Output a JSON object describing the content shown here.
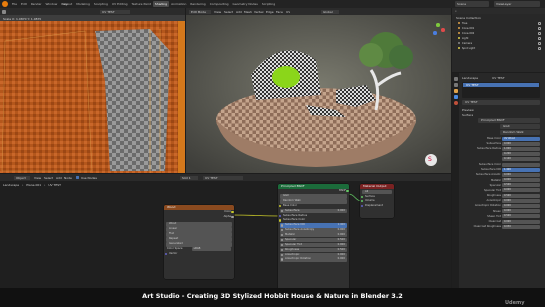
{
  "topbar": {
    "menus": [
      "File",
      "Edit",
      "Render",
      "Window",
      "Help"
    ],
    "workspaces": [
      "Layout",
      "Modeling",
      "Sculpting",
      "UV Editing",
      "Texture Paint",
      "Shading",
      "Animation",
      "Rendering",
      "Compositing",
      "Geometry Nodes",
      "Scripting"
    ],
    "active_workspace": "Shading",
    "scene": "Scene",
    "view_layer": "ViewLayer"
  },
  "image_editor": {
    "header": "UV TEST",
    "info": "Scale X: 1.0870  Y: 1.0870"
  },
  "viewport": {
    "mode": "Edit Mode",
    "view": "View",
    "select": "Select",
    "add": "Add",
    "mesh": "Mesh",
    "vertex": "Vertex",
    "edge": "Edge",
    "face": "Face",
    "uv": "UV",
    "orientation": "Global",
    "perspective": "User Perspective",
    "object_label": "(1) Plane.001",
    "options": "Options",
    "material_preview_label": "S"
  },
  "node_editor_header": {
    "editor": "Object",
    "view": "View",
    "select": "Select",
    "add": "Add",
    "node": "Node",
    "use_nodes": "Use Nodes",
    "slot": "Slot 1",
    "material": "UV TEST",
    "breadcrumb": [
      "Landscape",
      "Plane.001",
      "UV TEST"
    ]
  },
  "nodes": {
    "image": {
      "title": "Wood",
      "outputs": [
        "Color",
        "Alpha"
      ],
      "image_name": "Wood",
      "interpolation": "Linear",
      "projection": "Flat",
      "extension": "Repeat",
      "source": "Generated",
      "color_space_label": "Color Space",
      "color_space": "sRGB",
      "input": "Vector"
    },
    "bsdf": {
      "title": "Principled BSDF",
      "output": "BSDF",
      "distribution": "GGX",
      "subsurface_method": "Random Walk",
      "rows": [
        {
          "label": "Base Color",
          "value": ""
        },
        {
          "label": "Subsurface",
          "value": "0.000"
        },
        {
          "label": "Subsurface Radius",
          "value": ""
        },
        {
          "label": "Subsurface Color",
          "value": ""
        },
        {
          "label": "Subsurface IOR",
          "value": "1.400"
        },
        {
          "label": "Subsurface Anisotropy",
          "value": "0.000"
        },
        {
          "label": "Metallic",
          "value": "0.000"
        },
        {
          "label": "Specular",
          "value": "0.500"
        },
        {
          "label": "Specular Tint",
          "value": "0.000"
        },
        {
          "label": "Roughness",
          "value": "0.500"
        },
        {
          "label": "Anisotropic",
          "value": "0.000"
        },
        {
          "label": "Anisotropic Rotation",
          "value": "0.000"
        }
      ]
    },
    "output": {
      "title": "Material Output",
      "target": "All",
      "inputs": [
        "Surface",
        "Volume",
        "Displacement"
      ]
    }
  },
  "outliner": {
    "header": "Scene Collection",
    "items": [
      "Tree",
      "Cone.001",
      "Cone.002",
      "Light",
      "Camera",
      "Spot Light"
    ]
  },
  "properties": {
    "object": "Landscape",
    "material": "UV TEST",
    "buttons": [
      "Preview",
      "Surface"
    ],
    "surface": "Principled BSDF",
    "distribution": "GGX",
    "subsurface_method": "Random Walk",
    "rows": [
      {
        "label": "Base Color",
        "value": "UV Wood"
      },
      {
        "label": "Subsurface",
        "value": "0.000"
      },
      {
        "label": "Subsurface Radius",
        "value": "1.000"
      },
      {
        "label": "",
        "value": "0.200"
      },
      {
        "label": "",
        "value": "0.100"
      },
      {
        "label": "Subsurface Color",
        "value": ""
      },
      {
        "label": "Subsurface IOR",
        "value": "1.400"
      },
      {
        "label": "Subsurface Anisotr.",
        "value": "0.000"
      },
      {
        "label": "Metallic",
        "value": "0.000"
      },
      {
        "label": "Specular",
        "value": "0.500"
      },
      {
        "label": "Specular Tint",
        "value": "0.000"
      },
      {
        "label": "Roughness",
        "value": "0.500"
      },
      {
        "label": "Anisotropic",
        "value": "0.000"
      },
      {
        "label": "Anisotropic Rotation",
        "value": "0.000"
      },
      {
        "label": "Sheen",
        "value": "0.000"
      },
      {
        "label": "Sheen Tint",
        "value": "0.500"
      },
      {
        "label": "Clearcoat",
        "value": "0.000"
      },
      {
        "label": "Clearcoat Roughness",
        "value": "0.030"
      }
    ]
  },
  "caption": "Art Studio - Creating 3D Stylized Hobbit House & Nature in Blender 3.2",
  "watermark": "Udemy",
  "colors": {
    "accent": "#4772b3",
    "yellow_socket": "#c7c729",
    "grey_socket": "#a1a1a1",
    "green_socket": "#63c763",
    "purple_socket": "#6363c7",
    "node_output_header": "#1b6b3a",
    "image_node_header": "#8a4a1f",
    "lime": "#8bd61a"
  }
}
